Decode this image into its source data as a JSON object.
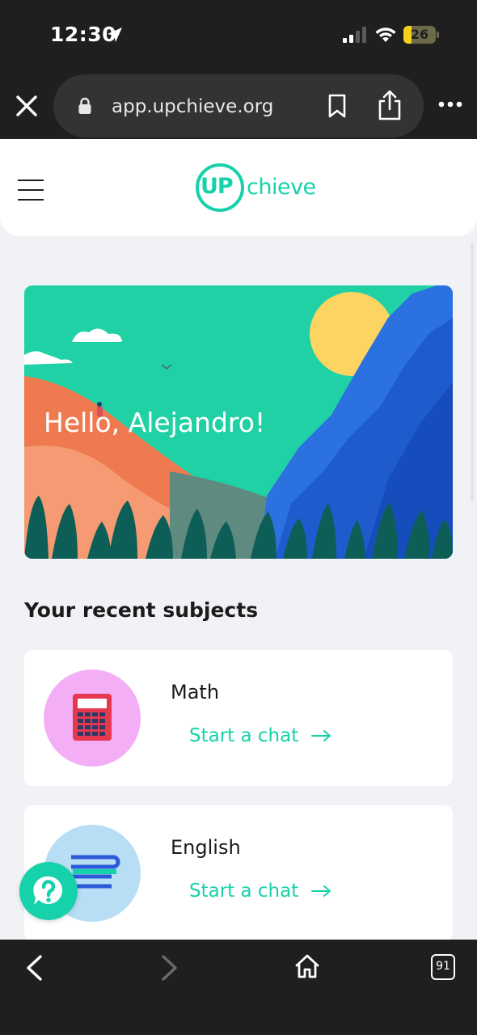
{
  "status_bar": {
    "time": "12:30",
    "battery_level": "26",
    "battery_fraction": 0.26,
    "icons": [
      "location-arrow-icon",
      "cellular-signal-icon",
      "wifi-icon",
      "battery-icon"
    ]
  },
  "browser": {
    "url": "app.upchieve.org",
    "icons": [
      "close-icon",
      "lock-icon",
      "bookmark-icon",
      "share-icon",
      "more-icon"
    ]
  },
  "header": {
    "logo_up": "UP",
    "logo_rest": "chieve"
  },
  "hero": {
    "greeting": "Hello, Alejandro!"
  },
  "recent": {
    "title": "Your recent subjects",
    "subjects": [
      {
        "name": "Math",
        "action": "Start a chat",
        "icon": "calculator-icon",
        "color": "#f4aef5"
      },
      {
        "name": "English",
        "action": "Start a chat",
        "icon": "books-icon",
        "color": "#b7def5"
      }
    ]
  },
  "toolbar": {
    "tab_count": "91",
    "icons": [
      "back-icon",
      "forward-icon",
      "home-icon",
      "tabs-icon"
    ]
  },
  "colors": {
    "accent": "#16d2aa",
    "dark_bar": "#1f1f1f",
    "page_bg": "#f1f2f6"
  }
}
